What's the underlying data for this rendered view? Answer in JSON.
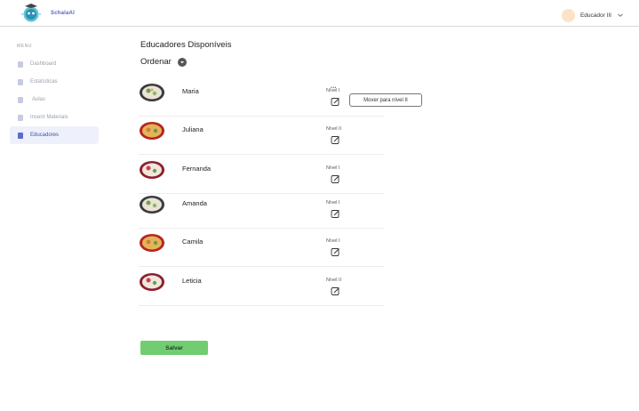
{
  "header": {
    "brand": "SchalaAI",
    "logo_icon": "brain-robot-logo-icon",
    "user_name": "Educador III",
    "avatar_color": "#fde2c9",
    "dropdown_icon": "chevron-down-icon"
  },
  "sidebar": {
    "menu_title": "MENU",
    "active_color": "#3f4fa3",
    "items": [
      {
        "label": "Dashboard",
        "icon": "chart-icon",
        "active": false
      },
      {
        "label": "Estatísticas",
        "icon": "document-icon",
        "active": false
      },
      {
        "label": "Aulas",
        "icon": "document-icon",
        "active": false
      },
      {
        "label": "Inserir Materiais",
        "icon": "document-icon",
        "active": false
      },
      {
        "label": "Educadores",
        "icon": "document-icon",
        "active": true
      }
    ]
  },
  "main": {
    "title": "Educadores Disponíveis",
    "sort_label": "Ordenar",
    "sort_icon": "chevron-down-circle-icon",
    "move_button": "Mover para nível II",
    "save_button": "Salvar",
    "save_color": "#72cc72",
    "educators": [
      {
        "name": "Maria",
        "level": "Nível I",
        "thumb": "salad-bowl-icon"
      },
      {
        "name": "Juliana",
        "level": "Nível II",
        "thumb": "food-plate-icon"
      },
      {
        "name": "Fernanda",
        "level": "Nível I",
        "thumb": "salad-bowl-icon"
      },
      {
        "name": "Amanda",
        "level": "Nível I",
        "thumb": "salad-bowl-icon"
      },
      {
        "name": "Camila",
        "level": "Nível I",
        "thumb": "food-plate-icon"
      },
      {
        "name": "Leticia",
        "level": "Nível II",
        "thumb": "salad-bowl-icon"
      }
    ]
  }
}
